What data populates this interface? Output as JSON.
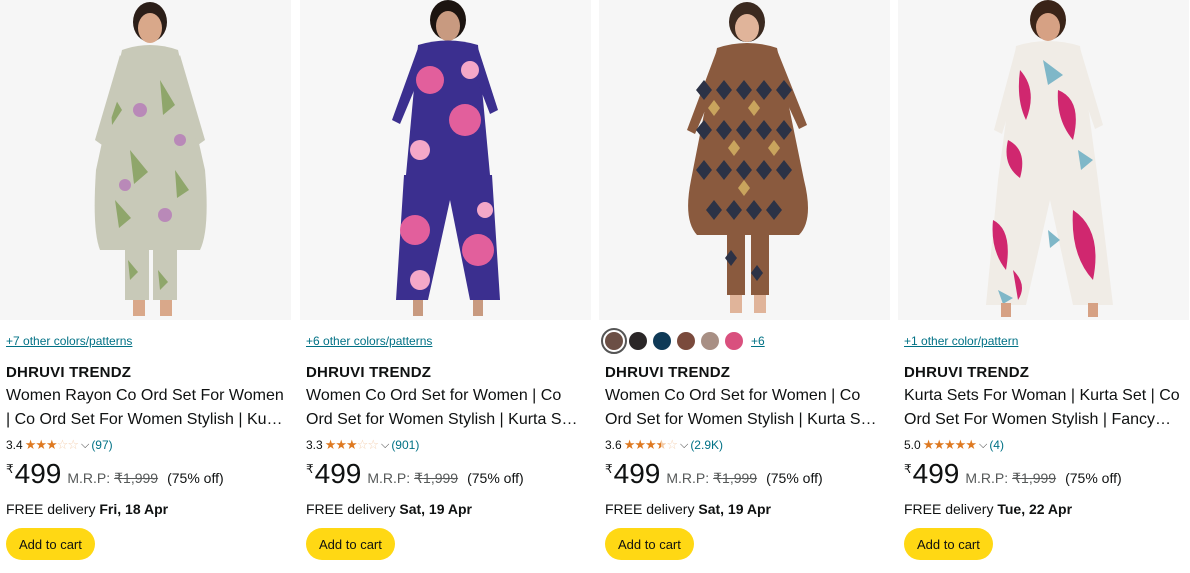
{
  "products": [
    {
      "variant_text": "+7 other colors/patterns",
      "brand": "DHRUVI TRENDZ",
      "title_line1": "Women Rayon Co Ord Set For Women",
      "title_line2": "| Co Ord Set For Women Stylish | Ku…",
      "rating": "3.4",
      "reviews": "(97)",
      "currency": "₹",
      "price": "499",
      "mrp_label": "M.R.P:",
      "mrp": "₹1,999",
      "discount": "(75% off)",
      "delivery_prefix": "FREE delivery",
      "delivery_date": "Fri, 18 Apr",
      "cart_label": "Add to cart",
      "image_palette": {
        "bg": "#f6f6f6",
        "top": "#c8c9b8",
        "print": "#8fa66b",
        "accent": "#b989b8",
        "skin": "#d9a88a",
        "hair": "#2b1e18"
      }
    },
    {
      "variant_text": "+6 other colors/patterns",
      "brand": "DHRUVI TRENDZ",
      "title_line1": "Women Co Ord Set for Women | Co",
      "title_line2": "Ord Set for Women Stylish | Kurta S…",
      "rating": "3.3",
      "reviews": "(901)",
      "currency": "₹",
      "price": "499",
      "mrp_label": "M.R.P:",
      "mrp": "₹1,999",
      "discount": "(75% off)",
      "delivery_prefix": "FREE delivery",
      "delivery_date": "Sat, 19 Apr",
      "cart_label": "Add to cart",
      "image_palette": {
        "bg": "#f7f7f7",
        "top": "#3b2f8f",
        "print": "#e25f9c",
        "accent": "#f4a8c8",
        "skin": "#c89a80",
        "hair": "#1c1410"
      }
    },
    {
      "swatches": [
        "#6b4f45",
        "#2a2627",
        "#0f3a57",
        "#7a4a3c",
        "#a88f84",
        "#d9507e"
      ],
      "more_swatches": "+6",
      "brand": "DHRUVI TRENDZ",
      "title_line1": "Women Co Ord Set for Women | Co",
      "title_line2": "Ord Set for Women Stylish | Kurta S…",
      "rating": "3.6",
      "reviews": "(2.9K)",
      "currency": "₹",
      "price": "499",
      "mrp_label": "M.R.P:",
      "mrp": "₹1,999",
      "discount": "(75% off)",
      "delivery_prefix": "FREE delivery",
      "delivery_date": "Sat, 19 Apr",
      "cart_label": "Add to cart",
      "image_palette": {
        "bg": "#f6f6f6",
        "top": "#8a5a3e",
        "print": "#2c3246",
        "accent": "#c9a45d",
        "skin": "#e0b49a",
        "hair": "#3b2a20"
      }
    },
    {
      "variant_text": "+1 other color/pattern",
      "brand": "DHRUVI TRENDZ",
      "title_line1": "Kurta Sets For Woman | Kurta Set | Co",
      "title_line2": "Ord Set For Women Stylish | Fancy…",
      "rating": "5.0",
      "reviews": "(4)",
      "currency": "₹",
      "price": "499",
      "mrp_label": "M.R.P:",
      "mrp": "₹1,999",
      "discount": "(75% off)",
      "delivery_prefix": "FREE delivery",
      "delivery_date": "Tue, 22 Apr",
      "cart_label": "Add to cart",
      "image_palette": {
        "bg": "#f6f6f6",
        "top": "#f0ece6",
        "print": "#d0276f",
        "accent": "#7fb7c8",
        "skin": "#d6a184",
        "hair": "#3a2418"
      }
    }
  ],
  "star_values": [
    3.4,
    3.3,
    3.6,
    5.0
  ],
  "colors": {
    "link": "#007185",
    "star": "#de7921",
    "cart_button": "#ffd814",
    "muted": "#565959"
  }
}
